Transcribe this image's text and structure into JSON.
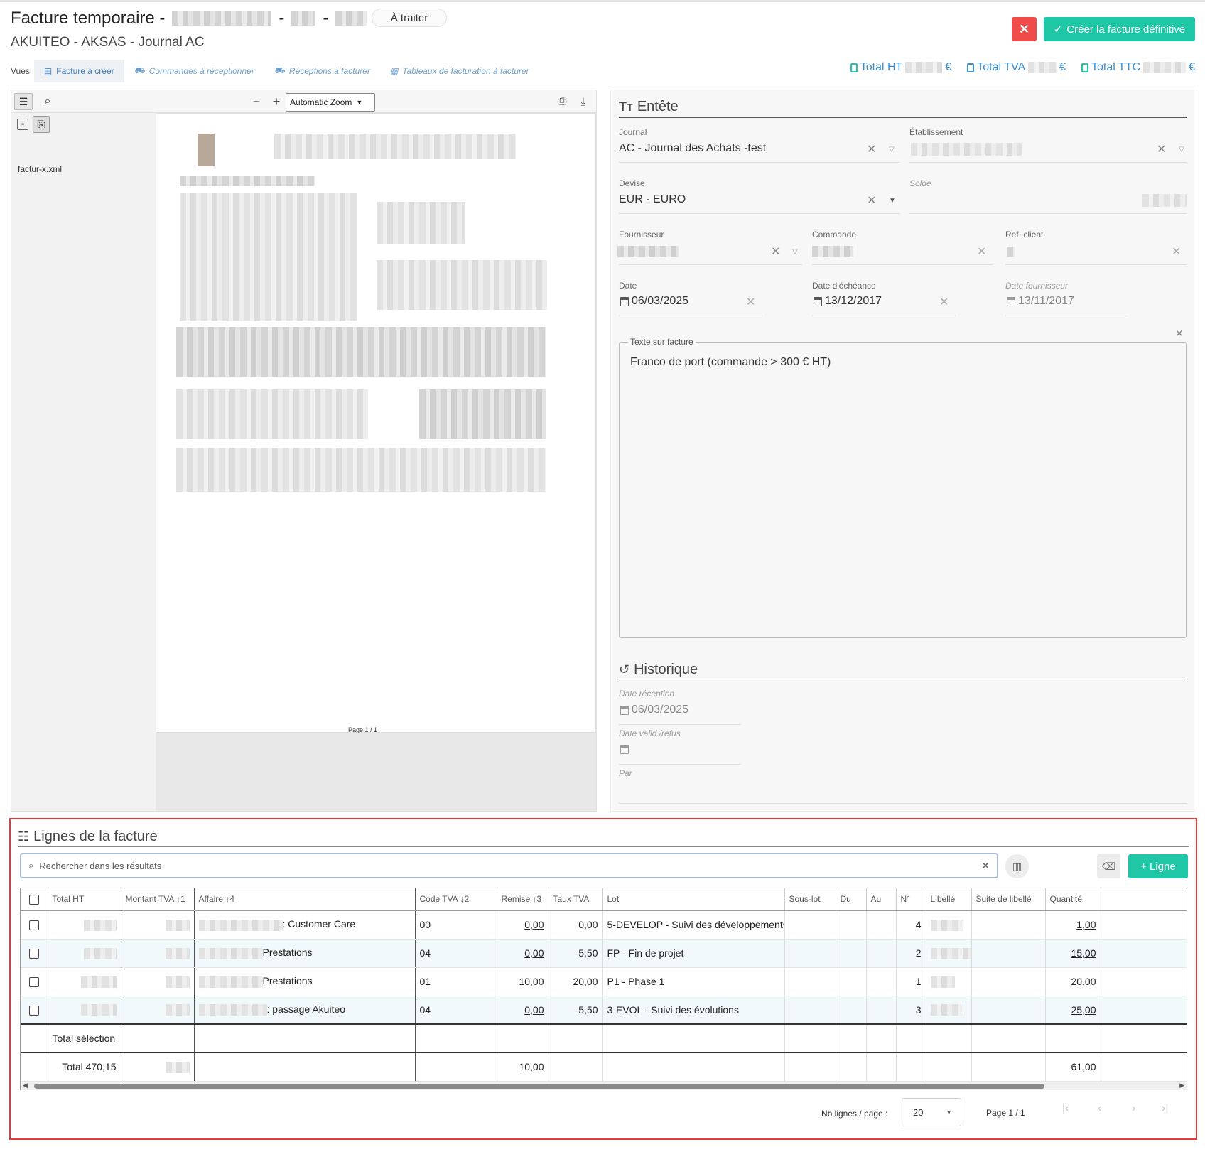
{
  "header": {
    "title": "Facture temporaire -",
    "status": "À traiter",
    "subtitle": "AKUITEO - AKSAS - Journal AC",
    "create_label": "Créer la facture définitive",
    "close_symbol": "✕"
  },
  "views": {
    "label": "Vues",
    "tabs": [
      {
        "label": "Facture à créer"
      },
      {
        "label": "Commandes à réceptionner"
      },
      {
        "label": "Réceptions à facturer"
      },
      {
        "label": "Tableaux de facturation à facturer"
      }
    ]
  },
  "totals": {
    "ht_label": "Total HT",
    "tva_label": "Total TVA",
    "ttc_label": "Total TTC",
    "currency": "€"
  },
  "viewer": {
    "zoom": "Automatic Zoom",
    "attachment": "factur-x.xml",
    "page_footer": "Page 1 / 1"
  },
  "entete": {
    "title": "Entête",
    "journal_label": "Journal",
    "journal_value": "AC - Journal des Achats -test",
    "etablissement_label": "Établissement",
    "devise_label": "Devise",
    "devise_value": "EUR - EURO",
    "solde_label": "Solde",
    "fournisseur_label": "Fournisseur",
    "commande_label": "Commande",
    "ref_client_label": "Ref. client",
    "date_label": "Date",
    "date_value": "06/03/2025",
    "echeance_label": "Date d'échéance",
    "echeance_value": "13/12/2017",
    "date_fournisseur_label": "Date fournisseur",
    "date_fournisseur_value": "13/11/2017",
    "texte_label": "Texte sur facture",
    "texte_value": "Franco de port (commande > 300 € HT)"
  },
  "historique": {
    "title": "Historique",
    "reception_label": "Date réception",
    "reception_value": "06/03/2025",
    "valid_label": "Date valid./refus",
    "par_label": "Par"
  },
  "lignes": {
    "title": "Lignes de la facture",
    "search_placeholder": "Rechercher dans les résultats",
    "add_label": "Ligne",
    "columns": [
      "Total HT",
      "Montant TVA",
      "Affaire",
      "Code TVA",
      "Remise",
      "Taux TVA",
      "Lot",
      "Sous-lot",
      "Du",
      "Au",
      "N°",
      "Libellé",
      "Suite de libellé",
      "Quantité"
    ],
    "sort_marks": {
      "montant_tva": "1",
      "affaire": "4",
      "code_tva": "2",
      "remise": "3"
    },
    "rows": [
      {
        "affaire": ": Customer Care",
        "code_tva": "00",
        "remise": "0,00",
        "taux_tva": "0,00",
        "lot": "5-DEVELOP - Suivi des développements",
        "numero": "4",
        "quantite": "1,00"
      },
      {
        "affaire": "Prestations",
        "code_tva": "04",
        "remise": "0,00",
        "taux_tva": "5,50",
        "lot": "FP - Fin de projet",
        "numero": "2",
        "quantite": "15,00"
      },
      {
        "affaire": "Prestations",
        "code_tva": "01",
        "remise": "10,00",
        "taux_tva": "20,00",
        "lot": "P1 - Phase 1",
        "numero": "1",
        "quantite": "20,00"
      },
      {
        "affaire": ": passage Akuiteo",
        "code_tva": "04",
        "remise": "0,00",
        "taux_tva": "5,50",
        "lot": "3-EVOL - Suivi des évolutions",
        "numero": "3",
        "quantite": "25,00"
      }
    ],
    "total_selection": "Total sélection",
    "total_label": "Total 470,15",
    "total_remise": "10,00",
    "total_quantite": "61,00",
    "pager": {
      "per_page_label": "Nb lignes / page :",
      "per_page": "20",
      "page_label": "Page 1 / 1"
    }
  }
}
